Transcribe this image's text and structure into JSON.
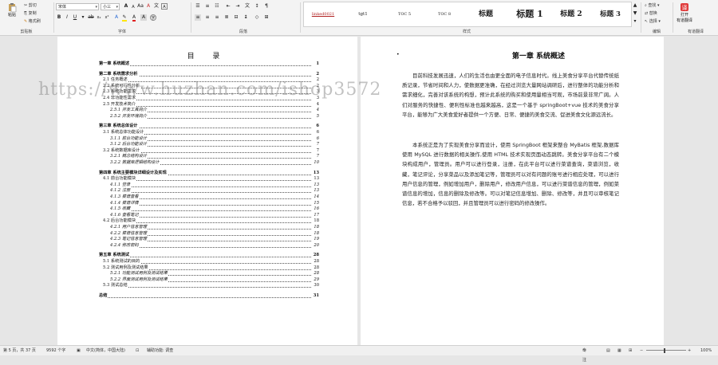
{
  "ribbon": {
    "clipboard": {
      "paste": "粘贴",
      "cut": "剪切",
      "copy": "复制",
      "format_painter": "格式刷",
      "group": "剪贴板"
    },
    "font": {
      "font_name": "宋体",
      "font_size": "小三",
      "group": "字体"
    },
    "paragraph": {
      "group": "段落"
    },
    "styles": {
      "group": "样式",
      "items": [
        "linked0021",
        "tgt1",
        "TOC 5",
        "TOC 8",
        "标题",
        "标题 1",
        "标题 2",
        "标题 3"
      ]
    },
    "editing": {
      "find": "查找",
      "replace": "替换",
      "select": "选择",
      "group": "编辑"
    },
    "translate": {
      "open": "打开",
      "translate": "有道翻译",
      "group": "有道翻译"
    }
  },
  "toc": {
    "title": "目 录",
    "entries": [
      {
        "level": 1,
        "text": "第一章  系统概述",
        "page": "1"
      },
      {
        "level": 1,
        "text": "第二章  系统需求分析",
        "page": "2"
      },
      {
        "level": 2,
        "text": "2.1 任务概述",
        "page": "2"
      },
      {
        "level": 2,
        "text": "2.2 系统可行性分析",
        "page": "2"
      },
      {
        "level": 2,
        "text": "2.3 系统功能需求",
        "page": "3"
      },
      {
        "level": 2,
        "text": "2.4 非功能性需求",
        "page": "3"
      },
      {
        "level": 2,
        "text": "2.5 开发技术简介",
        "page": "4"
      },
      {
        "level": 3,
        "text": "2.5.1 开发工具简介",
        "page": "4"
      },
      {
        "level": 3,
        "text": "2.5.2 开发环境简介",
        "page": "5"
      },
      {
        "level": 1,
        "text": "第三章  系统总体设计",
        "page": "6"
      },
      {
        "level": 2,
        "text": "3.1 系统总体功能设计",
        "page": "6"
      },
      {
        "level": 3,
        "text": "3.1.1 前台功能设计",
        "page": "6"
      },
      {
        "level": 3,
        "text": "3.1.2 后台功能设计",
        "page": "7"
      },
      {
        "level": 2,
        "text": "3.2 系统数据库设计",
        "page": "7"
      },
      {
        "level": 3,
        "text": "3.2.1 概念结构设计",
        "page": "7"
      },
      {
        "level": 3,
        "text": "3.2.2 数据库逻辑结构设计",
        "page": "10"
      },
      {
        "level": 1,
        "text": "第四章  系统主要模块详细设计及实现",
        "page": "13"
      },
      {
        "level": 2,
        "text": "4.1 前台功能模块",
        "page": "13"
      },
      {
        "level": 3,
        "text": "4.1.1 登录",
        "page": "13"
      },
      {
        "level": 3,
        "text": "4.1.2 注册",
        "page": "13"
      },
      {
        "level": 3,
        "text": "4.1.3 菜谱查看",
        "page": "14"
      },
      {
        "level": 3,
        "text": "4.1.4 菜谱详情",
        "page": "15"
      },
      {
        "level": 3,
        "text": "4.1.5 收藏",
        "page": "16"
      },
      {
        "level": 3,
        "text": "4.1.6 查看笔记",
        "page": "17"
      },
      {
        "level": 2,
        "text": "4.2 后台功能模块",
        "page": "18"
      },
      {
        "level": 3,
        "text": "4.2.1 用户信息管理",
        "page": "18"
      },
      {
        "level": 3,
        "text": "4.2.2 菜谱信息管理",
        "page": "18"
      },
      {
        "level": 3,
        "text": "4.2.3 笔记信息管理",
        "page": "19"
      },
      {
        "level": 3,
        "text": "4.2.4 修改密码",
        "page": "20"
      },
      {
        "level": 1,
        "text": "第五章  系统测试",
        "page": "28"
      },
      {
        "level": 2,
        "text": "5.1 系统测试的目的",
        "page": "28"
      },
      {
        "level": 2,
        "text": "5.2 测试用例及测试结果",
        "page": "28"
      },
      {
        "level": 3,
        "text": "5.2.1 功能测试用例及测试结果",
        "page": "28"
      },
      {
        "level": 3,
        "text": "5.2.2 界面测试用例及测试结果",
        "page": "29"
      },
      {
        "level": 2,
        "text": "5.3 测试总结",
        "page": "30"
      },
      {
        "level": 1,
        "text": "总结",
        "page": "31"
      }
    ]
  },
  "chapter": {
    "title": "第一章  系统概述",
    "para1": "目前科技发展迅速，人们的生活也由更全面的电子信息时代。线上美食分享平台代替传统纸质记录，节省时间和人力，使数据更准确，在经过浏览大量网站调研后，进行整体的功能分析和需求细化，完善对该系统的构想，预计此系统的购买和使用量相当可观，市场前景非常广阔。人们对服务的快捷性、便利性标准也越来越高，这是一个基于 springBoot+vue 技术的美食分享平台，能够为广大美食爱好者提供一个方便、日常、便捷的美食交流、促进美食文化源远流长。",
    "para2": "本系统正是为了实现美食分享而设计，使用 SpringBoot 框架来整合 MyBatis 框架,数据库使用 MySQL 进行数据的相关操作,使用 HTML 技术实现页面动态跳转。美食分享平台有二个模块构成用户，管理员。用户可以进行登录，注册，在此平台可以进行菜谱查询，菜谱浏览，收藏，笔记评论，分享菜品以及添加笔记等，管理员可以对有问题的账号进行相应处理，可以进行用户信息的管理，例如增加用户，删除用户，修改用户信息，可以进行菜谱信息的管理，例如菜谱信息的增加，信息的删除及修改等。可以对笔记信息增加、删除、修改等，并且可以审核笔记信息，若不合格予以驳回，并且管理员可以进行密码的修改操作。"
  },
  "watermark": "https://www.huzhan.com/ishop3572",
  "status": {
    "page": "第 5 页，共 37 页",
    "words": "9592 个字",
    "lang": "中文(简体，中国大陆)",
    "accessibility": "辅助功能: 调查",
    "focus": "专注",
    "zoom": "100%"
  }
}
